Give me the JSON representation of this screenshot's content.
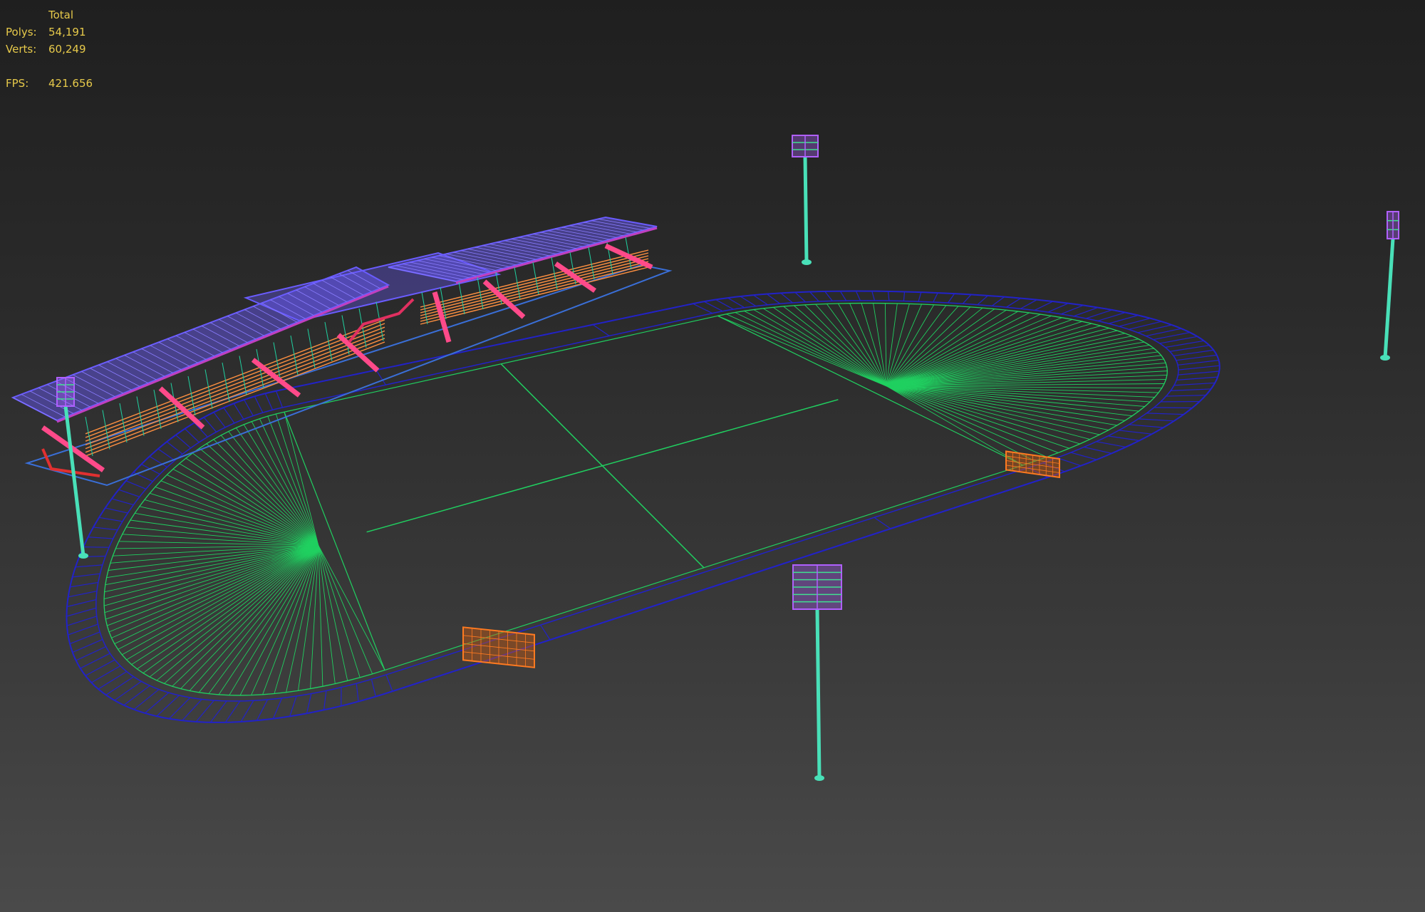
{
  "stats": {
    "header": "Total",
    "polys_label": "Polys:",
    "polys_value": "54,191",
    "verts_label": "Verts:",
    "verts_value": "60,249",
    "fps_label": "FPS:",
    "fps_value": "421.656"
  },
  "colors": {
    "text": "#e6c94a",
    "track": "#2222c8",
    "field": "#20d060",
    "grandstand_roof": "#6a5cff",
    "grandstand_beam": "#ff4a8a",
    "grandstand_seat": "#ff9040",
    "pole": "#49e0b8",
    "lamp": "#b060ff",
    "goal": "#ff7a20"
  },
  "objects": [
    "grandstand",
    "running-track",
    "football-field",
    "goal-north",
    "goal-south",
    "floodlight-north",
    "floodlight-east",
    "floodlight-south",
    "floodlight-west"
  ]
}
